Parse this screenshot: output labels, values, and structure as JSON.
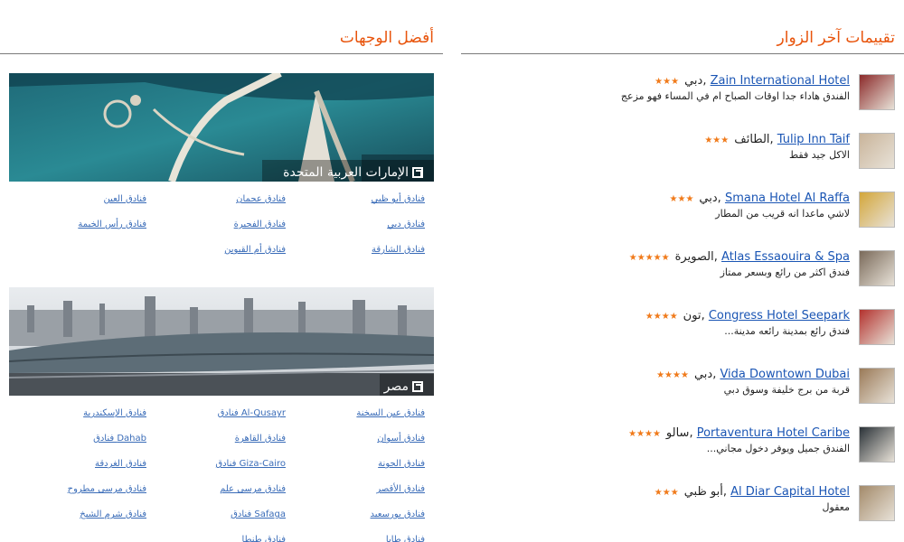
{
  "reviews_section": {
    "title": "تقييمات آخر الزوار",
    "items": [
      {
        "hotel": "Zain International Hotel",
        "city": "دبي",
        "stars": "★★★",
        "comment": "الفندق هاداء جدا اوقات الصباح ام في المساء فهو مزعج"
      },
      {
        "hotel": "Tulip Inn Taif",
        "city": "الطائف",
        "stars": "★★★",
        "comment": "الاكل جيد فقط"
      },
      {
        "hotel": "Smana Hotel Al Raffa",
        "city": "دبي",
        "stars": "★★★",
        "comment": "لاشي ماعدا انه قريب من المطار"
      },
      {
        "hotel": "Atlas Essaouira & Spa",
        "city": "الصويرة",
        "stars": "★★★★★",
        "comment": "فندق اكثر من رائع وبسعر ممتاز"
      },
      {
        "hotel": "Congress Hotel Seepark",
        "city": "تون",
        "stars": "★★★★",
        "comment": "فندق رائع بمدينة رائعه مدينة..."
      },
      {
        "hotel": "Vida Downtown Dubai",
        "city": "دبي",
        "stars": "★★★★",
        "comment": "قربة من برج خليفة وسوق دبي"
      },
      {
        "hotel": "Portaventura Hotel Caribe",
        "city": "سالو",
        "stars": "★★★★",
        "comment": "الفندق جميل ويوفر دخول مجاني..."
      },
      {
        "hotel": "Al Diar Capital Hotel",
        "city": "أبو ظبي",
        "stars": "★★★",
        "comment": "معقول"
      }
    ]
  },
  "destinations_section": {
    "title": "أفضل الوجهات",
    "uae": {
      "caption": "الإمارات العربية المتحدة",
      "links": [
        [
          "فنادق أبو ظبي",
          "فنادق عجمان",
          "فنادق العين"
        ],
        [
          "فنادق دبي",
          "فنادق الفجيرة",
          "فنادق رأس الخيمة"
        ],
        [
          "فنادق الشارقة",
          "فنادق أم القيوين",
          ""
        ]
      ]
    },
    "egypt": {
      "caption": "مصر",
      "links": [
        [
          "فنادق عين السخنة",
          "Al-Qusayr فنادق",
          "فنادق الإسكندرية"
        ],
        [
          "فنادق أسوان",
          "فنادق القاهرة",
          "Dahab فنادق"
        ],
        [
          "فنادق الجونة",
          "Giza-Cairo فنادق",
          "فنادق الغردقة"
        ],
        [
          "فنادق الأقصر",
          "فنادق مرسى علم",
          "فنادق مرسى مطروح"
        ],
        [
          "فنادق بورسعيد",
          "Safaga فنادق",
          "فنادق شرم الشيخ"
        ],
        [
          "فنادق طابا",
          "فنادق طنطا",
          ""
        ]
      ]
    }
  },
  "colors": {
    "accent": "#e8540c",
    "link": "#1a55b4",
    "star": "#f07a1a"
  }
}
